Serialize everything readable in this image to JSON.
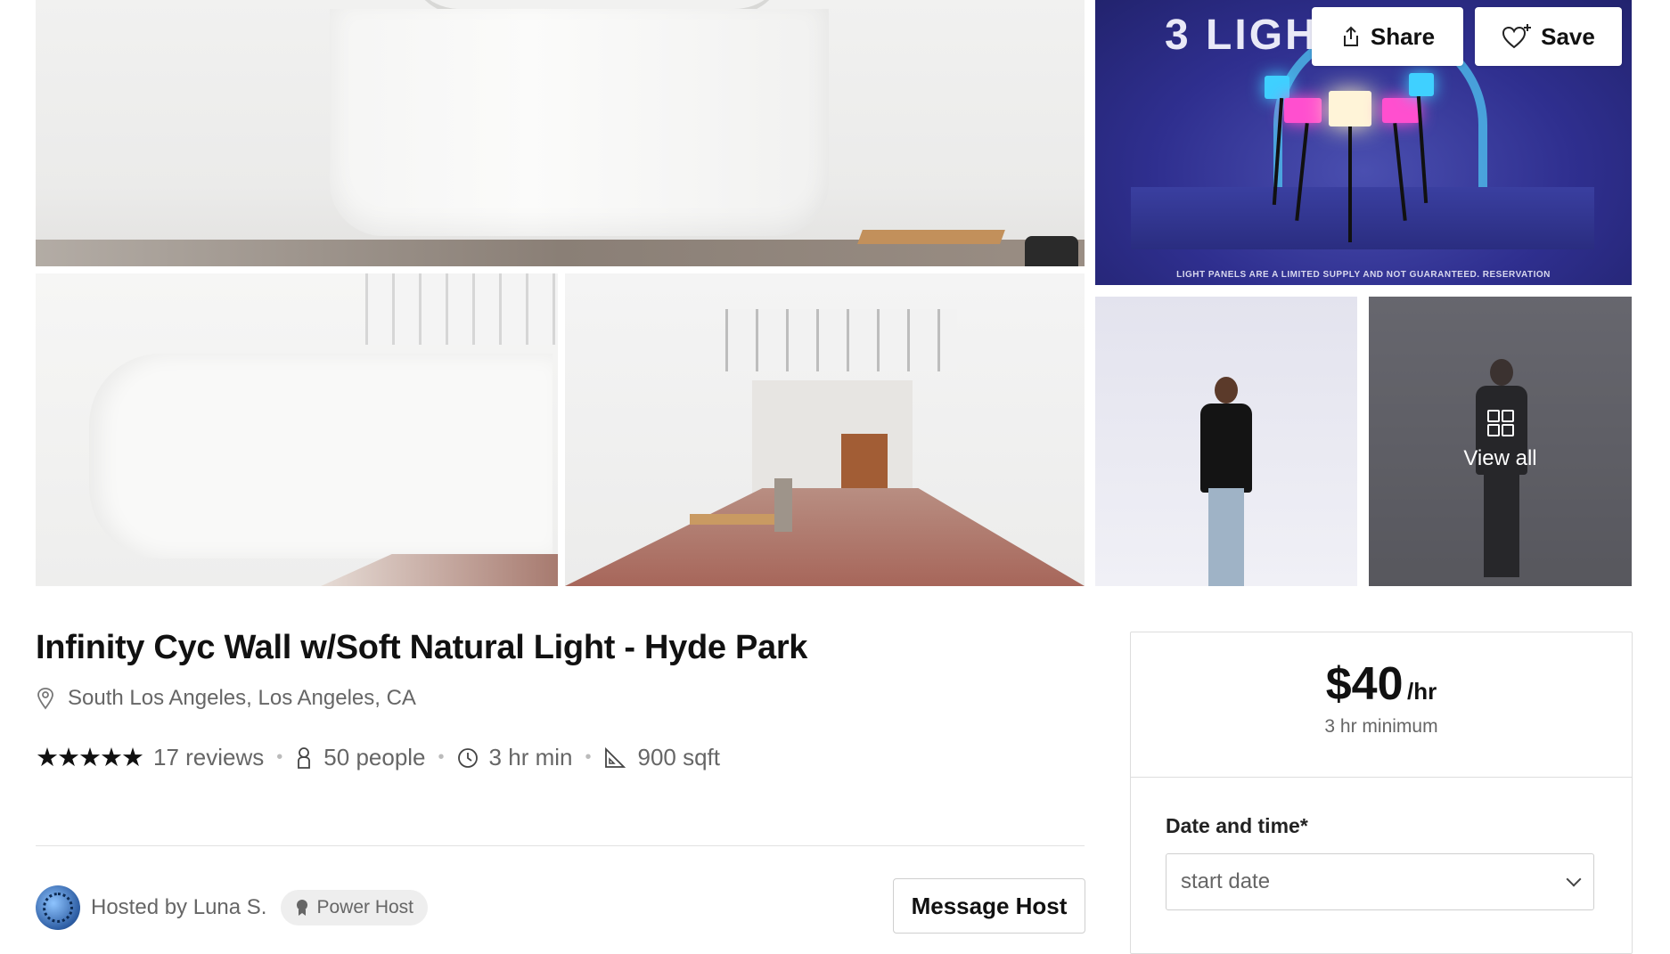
{
  "photos": {
    "promo_headline": "3 LIGH",
    "promo_disclaimer": "LIGHT PANELS ARE A LIMITED SUPPLY AND NOT GUARANTEED. RESERVATION",
    "view_all_label": "View all"
  },
  "actions": {
    "share_label": "Share",
    "save_label": "Save"
  },
  "listing": {
    "title": "Infinity Cyc Wall w/Soft Natural Light - Hyde Park",
    "location": "South Los Angeles, Los Angeles, CA",
    "rating_stars": 5,
    "reviews": "17 reviews",
    "capacity": "50 people",
    "min_hours": "3 hr min",
    "size": "900 sqft"
  },
  "host": {
    "hosted_by": "Hosted by Luna S.",
    "badge": "Power Host",
    "message_label": "Message Host"
  },
  "booking": {
    "price": "$40",
    "unit": "/hr",
    "minimum": "3 hr minimum",
    "date_label": "Date and time*",
    "start_date_placeholder": "start date"
  }
}
